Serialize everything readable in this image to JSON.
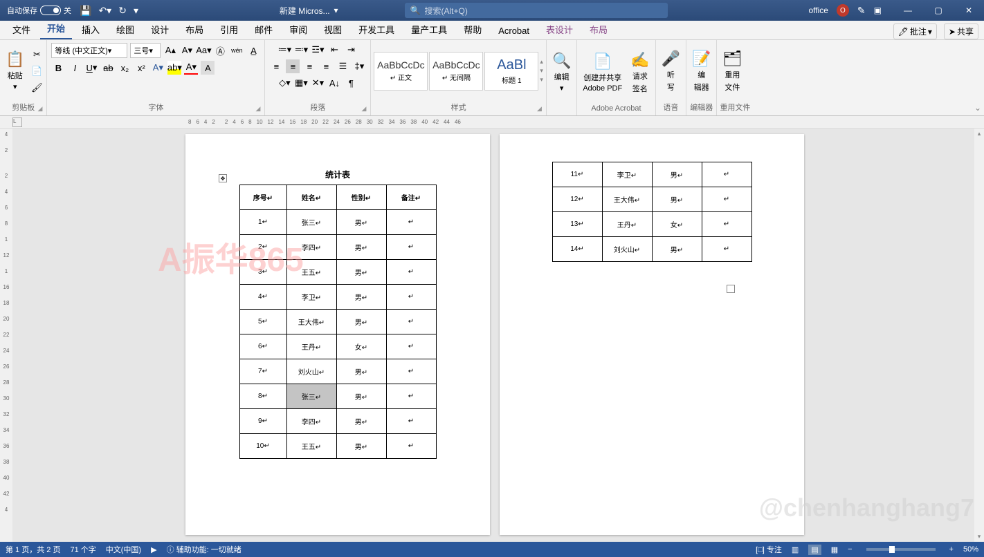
{
  "title": {
    "autosave": "自动保存",
    "autosave_state": "关",
    "docname": "新建 Micros...",
    "search_placeholder": "搜索(Alt+Q)",
    "account": "office"
  },
  "tabs": [
    "文件",
    "开始",
    "插入",
    "绘图",
    "设计",
    "布局",
    "引用",
    "邮件",
    "审阅",
    "视图",
    "开发工具",
    "量产工具",
    "帮助",
    "Acrobat",
    "表设计",
    "布局"
  ],
  "tabs_active_index": 1,
  "ribbon_right": {
    "comment": "批注",
    "share": "共享"
  },
  "groups": {
    "clipboard": "剪贴板",
    "font": "字体",
    "paragraph": "段落",
    "styles": "样式",
    "editing": "编辑",
    "acrobat": "Adobe Acrobat",
    "voice": "语音",
    "editor": "编辑器",
    "reuse": "重用文件"
  },
  "font": {
    "name": "等线 (中文正文)",
    "size": "三号"
  },
  "clipboard": {
    "paste": "粘贴"
  },
  "styles": [
    {
      "preview": "AaBbCcDc",
      "name": "↵ 正文"
    },
    {
      "preview": "AaBbCcDc",
      "name": "↵ 无间隔"
    },
    {
      "preview": "AaBl",
      "name": "标题 1"
    }
  ],
  "bigbtns": {
    "edit": "编辑",
    "pdf1": "创建并共享",
    "pdf1b": "Adobe PDF",
    "sig": "请求",
    "sigb": "签名",
    "dict": "听",
    "dictb": "写",
    "editor": "编",
    "editorb": "辑器",
    "reuse": "重用",
    "reuseb": "文件"
  },
  "ruler_ticks": [
    "8",
    "6",
    "4",
    "2",
    "",
    "2",
    "4",
    "6",
    "8",
    "10",
    "12",
    "14",
    "16",
    "18",
    "20",
    "22",
    "24",
    "26",
    "28",
    "30",
    "32",
    "34",
    "36",
    "38",
    "40",
    "42",
    "44",
    "46"
  ],
  "vruler": [
    "4",
    "2",
    "",
    "2",
    "4",
    "6",
    "8",
    "1",
    "12",
    "1",
    "16",
    "18",
    "20",
    "22",
    "24",
    "26",
    "28",
    "30",
    "32",
    "34",
    "36",
    "38",
    "40",
    "42",
    "4"
  ],
  "doc": {
    "title": "统计表",
    "headers": [
      "序号",
      "姓名",
      "性别",
      "备注"
    ],
    "rows_p1": [
      [
        "1",
        "张三",
        "男",
        ""
      ],
      [
        "2",
        "李四",
        "男",
        ""
      ],
      [
        "3",
        "王五",
        "男",
        ""
      ],
      [
        "4",
        "李卫",
        "男",
        ""
      ],
      [
        "5",
        "王大伟",
        "男",
        ""
      ],
      [
        "6",
        "王丹",
        "女",
        ""
      ],
      [
        "7",
        "刘火山",
        "男",
        ""
      ],
      [
        "8",
        "张三",
        "男",
        ""
      ],
      [
        "9",
        "李四",
        "男",
        ""
      ],
      [
        "10",
        "王五",
        "男",
        ""
      ]
    ],
    "rows_p2": [
      [
        "11",
        "李卫",
        "男",
        ""
      ],
      [
        "12",
        "王大伟",
        "男",
        ""
      ],
      [
        "13",
        "王丹",
        "女",
        ""
      ],
      [
        "14",
        "刘火山",
        "男",
        ""
      ]
    ],
    "highlight_row": 7,
    "highlight_col": 1
  },
  "watermarks": {
    "w1": "A振华865",
    "w2": "@chenhanghang7"
  },
  "status": {
    "page": "第 1 页，共 2 页",
    "words": "71 个字",
    "lang": "中文(中国)",
    "acc": "辅助功能: 一切就绪",
    "focus": "专注",
    "zoom": "50%"
  }
}
